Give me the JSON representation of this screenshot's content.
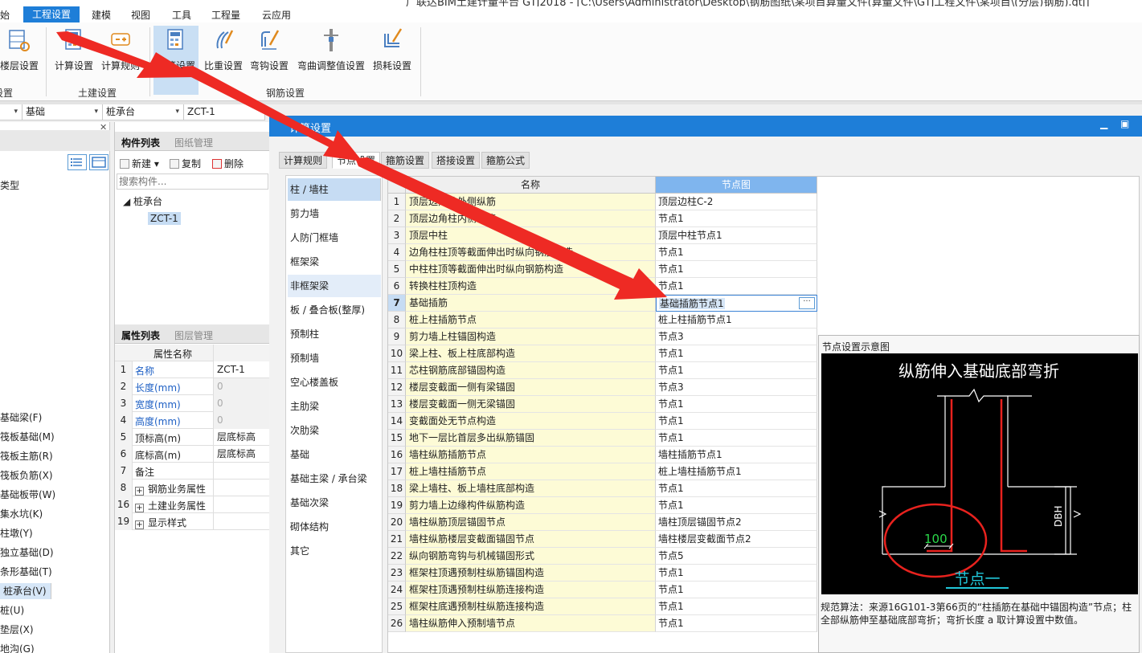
{
  "window": {
    "title_fragment": "广联达BIM土建计量平台 GTJ2018 - [C:\\Users\\Administrator\\Desktop\\钢筋图纸\\某项目算量文件(算量文件\\GTJ工程文件\\某项目\\(分层)钢筋).gtj]"
  },
  "menu": {
    "items": [
      "始",
      "工程设置",
      "建模",
      "视图",
      "工具",
      "工程量",
      "云应用"
    ],
    "active_index": 1
  },
  "ribbon": {
    "buttons": [
      "楼层设置",
      "计算设置",
      "计算规则",
      "计算设置",
      "比重设置",
      "弯钩设置",
      "弯曲调整值设置",
      "损耗设置"
    ],
    "groups": [
      "设置",
      "土建设置",
      "钢筋设置"
    ]
  },
  "selectors": [
    "",
    "基础",
    "桩承台",
    "ZCT-1"
  ],
  "left_panel": {
    "type_label": "类型",
    "items": [
      "基础梁(F)",
      "筏板基础(M)",
      "筏板主筋(R)",
      "筏板负筋(X)",
      "基础板带(W)",
      "集水坑(K)",
      "柱墩(Y)",
      "独立基础(D)",
      "条形基础(T)",
      "桩承台(V)",
      "桩(U)",
      "垫层(X)",
      "地沟(G)"
    ],
    "selected_index": 9
  },
  "component_panel": {
    "tabs": [
      "构件列表",
      "图纸管理"
    ],
    "tools": [
      "新建",
      "复制",
      "删除"
    ],
    "search_placeholder": "搜索构件...",
    "tree_root": "桩承台",
    "tree_child": "ZCT-1"
  },
  "property_panel": {
    "tabs": [
      "属性列表",
      "图层管理"
    ],
    "header": "属性名称",
    "rows": [
      {
        "num": "1",
        "name": "名称",
        "value": "ZCT-1",
        "blue": true
      },
      {
        "num": "2",
        "name": "长度(mm)",
        "value": "0",
        "blue": true
      },
      {
        "num": "3",
        "name": "宽度(mm)",
        "value": "0",
        "blue": true
      },
      {
        "num": "4",
        "name": "高度(mm)",
        "value": "0",
        "blue": true
      },
      {
        "num": "5",
        "name": "顶标高(m)",
        "value": "层底标高",
        "blue": false
      },
      {
        "num": "6",
        "name": "底标高(m)",
        "value": "层底标高",
        "blue": false
      },
      {
        "num": "7",
        "name": "备注",
        "value": "",
        "blue": false
      },
      {
        "num": "8",
        "name": "钢筋业务属性",
        "value": "",
        "blue": false,
        "expand": true
      },
      {
        "num": "16",
        "name": "土建业务属性",
        "value": "",
        "blue": false,
        "expand": true
      },
      {
        "num": "19",
        "name": "显示样式",
        "value": "",
        "blue": false,
        "expand": true
      }
    ]
  },
  "dialog": {
    "title": "计算设置",
    "tabs": [
      "计算规则",
      "节点设置",
      "箍筋设置",
      "搭接设置",
      "箍筋公式"
    ],
    "active_tab": 1,
    "categories": [
      "柱 / 墙柱",
      "剪力墙",
      "人防门框墙",
      "框架梁",
      "非框架梁",
      "板 / 叠合板(整厚)",
      "预制柱",
      "预制墙",
      "空心楼盖板",
      "主肋梁",
      "次肋梁",
      "基础",
      "基础主梁 / 承台梁",
      "基础次梁",
      "砌体结构",
      "其它"
    ],
    "selected_category": 0,
    "grid_headers": [
      "名称",
      "节点图"
    ],
    "rows": [
      {
        "no": "1",
        "name": "顶层边角柱外侧纵筋",
        "node": "顶层边柱C-2"
      },
      {
        "no": "2",
        "name": "顶层边角柱内侧纵筋",
        "node": "节点1"
      },
      {
        "no": "3",
        "name": "顶层中柱",
        "node": "顶层中柱节点1"
      },
      {
        "no": "4",
        "name": "边角柱柱顶等截面伸出时纵向钢筋构造",
        "node": "节点1"
      },
      {
        "no": "5",
        "name": "中柱柱顶等截面伸出时纵向钢筋构造",
        "node": "节点1"
      },
      {
        "no": "6",
        "name": "转换柱柱顶构造",
        "node": "节点1"
      },
      {
        "no": "7",
        "name": "基础插筋",
        "node": "基础插筋节点1"
      },
      {
        "no": "8",
        "name": "桩上柱插筋节点",
        "node": "桩上柱插筋节点1"
      },
      {
        "no": "9",
        "name": "剪力墙上柱锚固构造",
        "node": "节点3"
      },
      {
        "no": "10",
        "name": "梁上柱、板上柱底部构造",
        "node": "节点1"
      },
      {
        "no": "11",
        "name": "芯柱钢筋底部锚固构造",
        "node": "节点1"
      },
      {
        "no": "12",
        "name": "楼层变截面一侧有梁锚固",
        "node": "节点3"
      },
      {
        "no": "13",
        "name": "楼层变截面一侧无梁锚固",
        "node": "节点1"
      },
      {
        "no": "14",
        "name": "变截面处无节点构造",
        "node": "节点1"
      },
      {
        "no": "15",
        "name": "地下一层比首层多出纵筋锚固",
        "node": "节点1"
      },
      {
        "no": "16",
        "name": "墙柱纵筋插筋节点",
        "node": "墙柱插筋节点1"
      },
      {
        "no": "17",
        "name": "桩上墙柱插筋节点",
        "node": "桩上墙柱插筋节点1"
      },
      {
        "no": "18",
        "name": "梁上墙柱、板上墙柱底部构造",
        "node": "节点1"
      },
      {
        "no": "19",
        "name": "剪力墙上边缘构件纵筋构造",
        "node": "节点1"
      },
      {
        "no": "20",
        "name": "墙柱纵筋顶层锚固节点",
        "node": "墙柱顶层锚固节点2"
      },
      {
        "no": "21",
        "name": "墙柱纵筋楼层变截面锚固节点",
        "node": "墙柱楼层变截面节点2"
      },
      {
        "no": "22",
        "name": "纵向钢筋弯钩与机械锚固形式",
        "node": "节点5"
      },
      {
        "no": "23",
        "name": "框架柱顶遇预制柱纵筋锚固构造",
        "node": "节点1"
      },
      {
        "no": "24",
        "name": "框架柱顶遇预制柱纵筋连接构造",
        "node": "节点1"
      },
      {
        "no": "25",
        "name": "框架柱底遇预制柱纵筋连接构造",
        "node": "节点1"
      },
      {
        "no": "26",
        "name": "墙柱纵筋伸入预制墙节点",
        "node": "节点1"
      }
    ],
    "active_row": 6,
    "preview": {
      "title": "节点设置示意图",
      "diagram_title": "纵筋伸入基础底部弯折",
      "dim_label": "DBH",
      "bend_value": "100",
      "node_label": "节点一",
      "note": "规范算法：来源16G101-3第66页的“柱插筋在基础中锚固构造”节点；柱全部纵筋伸至基础底部弯折；弯折长度 a 取计算设置中数值。"
    }
  },
  "colors": {
    "accent": "#1e7ed8",
    "annotation_red": "#ee2a24",
    "name_cell_bg": "#fdfbd6",
    "diagram_rebar": "#e8221e",
    "diagram_label": "#21c6d8"
  }
}
